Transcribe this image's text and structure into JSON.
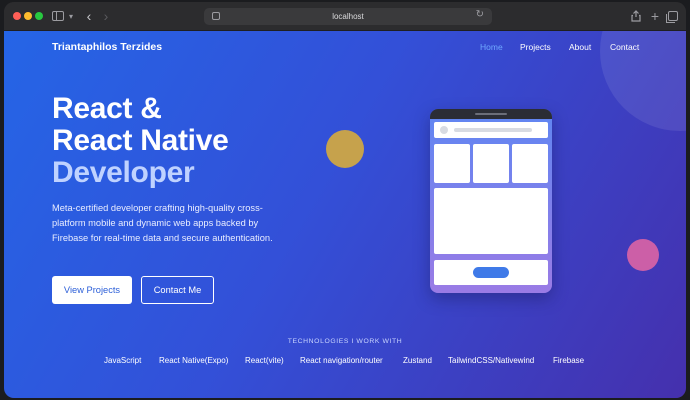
{
  "browser": {
    "url": "localhost",
    "icons": [
      "sidebar-icon",
      "chevron-down-icon",
      "back-arrow-icon",
      "forward-arrow-icon",
      "site-settings-icon",
      "reload-icon",
      "share-icon",
      "plus-icon",
      "tabs-overview-icon"
    ]
  },
  "header": {
    "brand": "Triantaphilos Terzides",
    "nav": [
      {
        "label": "Home",
        "active": true
      },
      {
        "label": "Projects",
        "active": false
      },
      {
        "label": "About",
        "active": false
      },
      {
        "label": "Contact",
        "active": false
      }
    ]
  },
  "hero": {
    "title_line1": "React &",
    "title_line2": "React Native",
    "title_line3": "Developer",
    "description": "Meta-certified developer crafting high-quality cross-platform mobile and dynamic web apps backed by Firebase for real-time data and secure authentication.",
    "primary_button": "View Projects",
    "secondary_button": "Contact Me"
  },
  "technologies": {
    "heading": "TECHNOLOGIES I WORK WITH",
    "items": [
      "JavaScript",
      "React Native(Expo)",
      "React(vite)",
      "React navigation/router",
      "Zustand",
      "TailwindCSS/Nativewind",
      "Firebase"
    ]
  },
  "colors": {
    "gradient_start": "#2565e6",
    "gradient_end": "#4530ad",
    "nav_active": "#6fa8ff",
    "accent_title": "#bfd2ff",
    "deco_yellow": "#c6a24c",
    "deco_pink": "#cc5fa7"
  }
}
